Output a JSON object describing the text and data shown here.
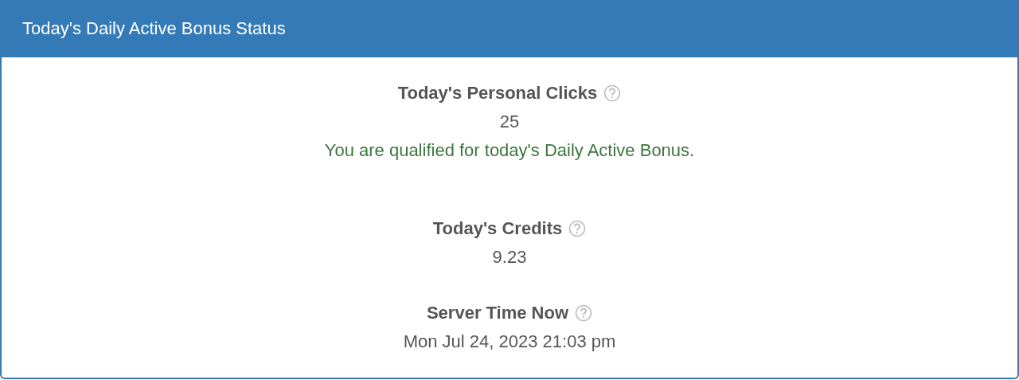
{
  "panel": {
    "title": "Today's Daily Active Bonus Status"
  },
  "stats": [
    {
      "label": "Today's Personal Clicks",
      "value": "25",
      "message": {
        "kind": "success",
        "text": "You are qualified for today's Daily Active Bonus."
      }
    },
    {
      "label": "Today's Credits",
      "value": "9.23"
    },
    {
      "label": "Server Time Now",
      "value": "Mon Jul 24, 2023 21:03 pm"
    }
  ]
}
